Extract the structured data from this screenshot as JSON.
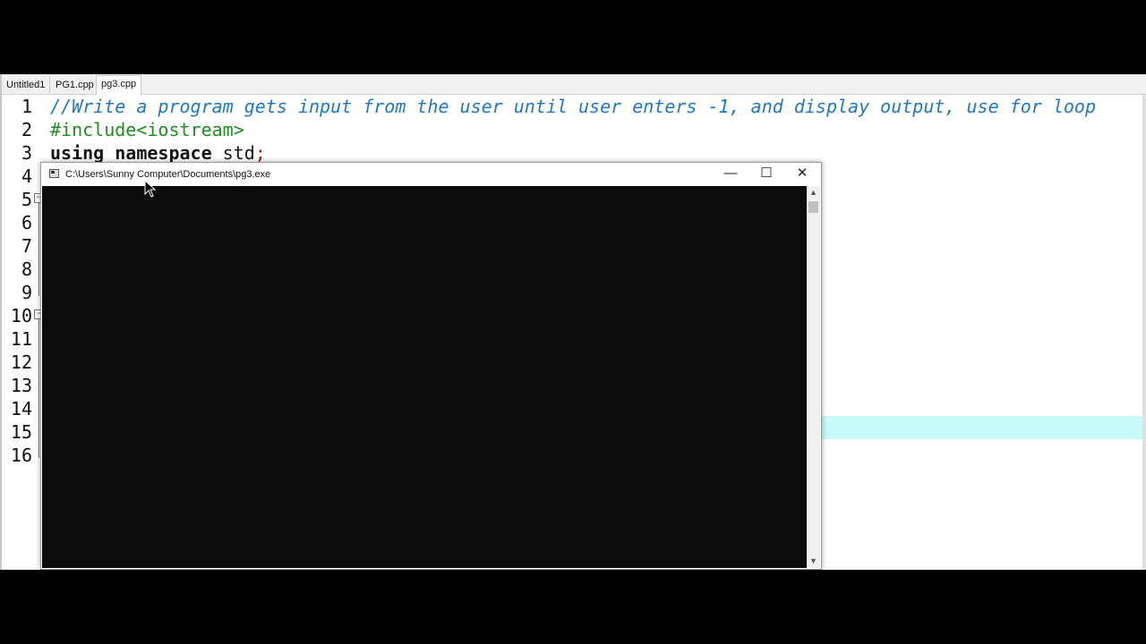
{
  "tabs": [
    {
      "label": "Untitled1"
    },
    {
      "label": "PG1.cpp"
    },
    {
      "label": "pg3.cpp"
    }
  ],
  "editor": {
    "line_numbers": [
      "1",
      "2",
      "3",
      "4",
      "5",
      "6",
      "7",
      "8",
      "9",
      "10",
      "11",
      "12",
      "13",
      "14",
      "15",
      "16"
    ],
    "line1": "//Write a program gets input from the user until user enters -1, and display output, use for loop",
    "line2": "#include<iostream>",
    "line3_kw": "using namespace",
    "line3_id": " std",
    "line3_sym": ";",
    "highlighted_line": 14
  },
  "console": {
    "title": "C:\\Users\\Sunny Computer\\Documents\\pg3.exe",
    "minimize_label": "—",
    "maximize_label": "☐",
    "close_label": "✕",
    "scroll_up": "▲",
    "scroll_down": "▼"
  },
  "colors": {
    "comment": "#1e78c8",
    "preprocessor": "#1f8f1f",
    "symbol": "#e00000",
    "highlight": "#c8fafa",
    "console_bg": "#0c0c0c"
  },
  "icons": [
    "console-app-icon",
    "minimize-icon",
    "maximize-icon",
    "close-icon",
    "mouse-pointer-icon"
  ]
}
